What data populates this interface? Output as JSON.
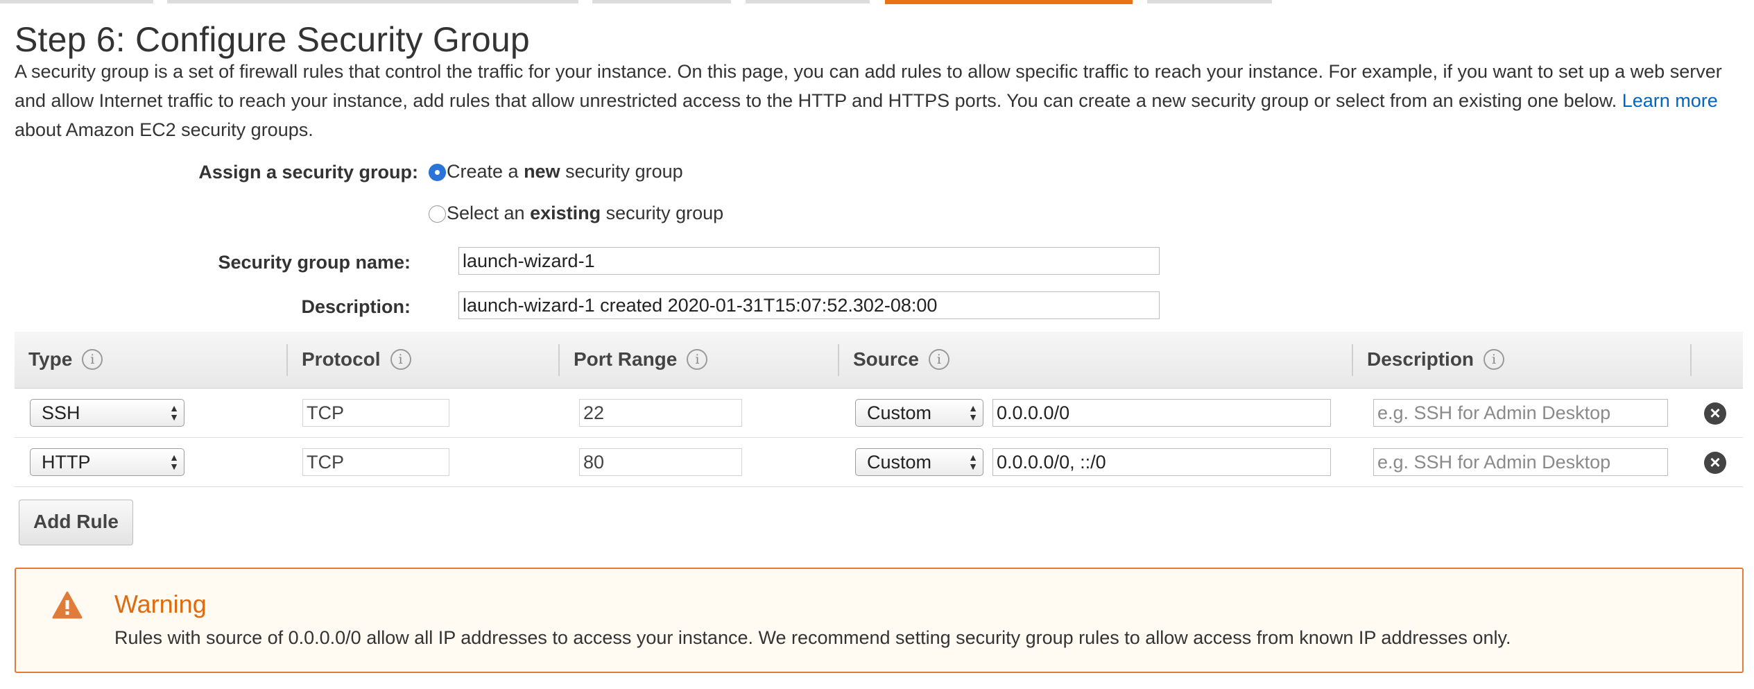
{
  "header": {
    "title": "Step 6: Configure Security Group",
    "intro_part1": "A security group is a set of firewall rules that control the traffic for your instance. On this page, you can add rules to allow specific traffic to reach your instance. For example, if you want to set up a web server and allow Internet traffic to reach your instance, add rules that allow unrestricted access to the HTTP and HTTPS ports. You can create a new security group or select from an existing one below.",
    "learn_more": "Learn more",
    "intro_part2": "about Amazon EC2 security groups."
  },
  "form": {
    "assign_label": "Assign a security group:",
    "option_new": {
      "pre": "Create a ",
      "bold": "new",
      "post": " security group",
      "selected": true
    },
    "option_existing": {
      "pre": "Select an ",
      "bold": "existing",
      "post": " security group",
      "selected": false
    },
    "name_label": "Security group name:",
    "name_value": "launch-wizard-1",
    "description_label": "Description:",
    "description_value": "launch-wizard-1 created 2020-01-31T15:07:52.302-08:00"
  },
  "table": {
    "headers": {
      "type": "Type",
      "protocol": "Protocol",
      "port_range": "Port Range",
      "source": "Source",
      "description": "Description"
    },
    "info_icon": "info-icon",
    "rows": [
      {
        "type": "SSH",
        "protocol": "TCP",
        "port_range": "22",
        "source_mode": "Custom",
        "source_value": "0.0.0.0/0",
        "description_placeholder": "e.g. SSH for Admin Desktop"
      },
      {
        "type": "HTTP",
        "protocol": "TCP",
        "port_range": "80",
        "source_mode": "Custom",
        "source_value": "0.0.0.0/0, ::/0",
        "description_placeholder": "e.g. SSH for Admin Desktop"
      }
    ],
    "add_rule_label": "Add Rule"
  },
  "warning": {
    "title": "Warning",
    "text": "Rules with source of 0.0.0.0/0 allow all IP addresses to access your instance. We recommend setting security group rules to allow access from known IP addresses only.",
    "icon": "warning-triangle-icon"
  },
  "colors": {
    "accent": "#ec7211",
    "link": "#0066c0",
    "radio_selected": "#2a73d8",
    "warning_border": "#e07b39",
    "warning_title": "#dd6b10"
  }
}
